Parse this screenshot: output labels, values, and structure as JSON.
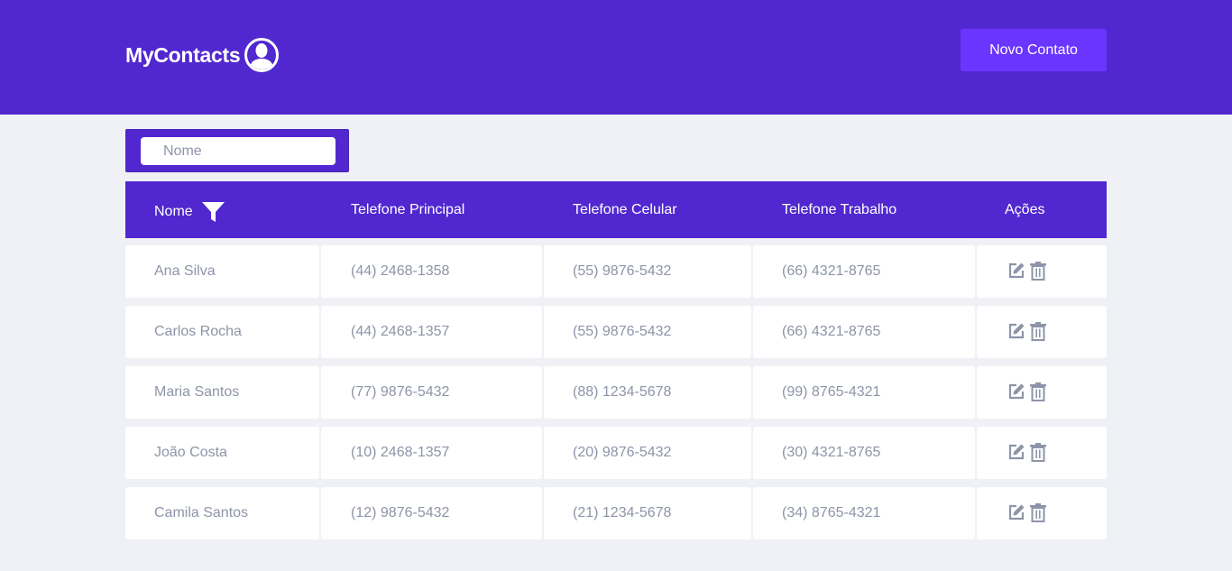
{
  "header": {
    "brand": "MyContacts",
    "new_contact_label": "Novo Contato"
  },
  "search": {
    "placeholder": "Nome"
  },
  "table": {
    "columns": [
      "Nome",
      "Telefone Principal",
      "Telefone Celular",
      "Telefone Trabalho",
      "Ações"
    ],
    "rows": [
      {
        "name": "Ana Silva",
        "principal": "(44) 2468-1358",
        "celular": "(55) 9876-5432",
        "trabalho": "(66) 4321-8765"
      },
      {
        "name": "Carlos Rocha",
        "principal": "(44) 2468-1357",
        "celular": "(55) 9876-5432",
        "trabalho": "(66) 4321-8765"
      },
      {
        "name": "Maria Santos",
        "principal": "(77) 9876-5432",
        "celular": "(88) 1234-5678",
        "trabalho": "(99) 8765-4321"
      },
      {
        "name": "João Costa",
        "principal": "(10) 2468-1357",
        "celular": "(20) 9876-5432",
        "trabalho": "(30) 4321-8765"
      },
      {
        "name": "Camila Santos",
        "principal": "(12) 9876-5432",
        "celular": "(21) 1234-5678",
        "trabalho": "(34) 8765-4321"
      }
    ]
  },
  "icons": {
    "brand": "user-circle-icon",
    "filter": "filter-icon",
    "edit": "edit-icon",
    "delete": "trash-icon"
  },
  "colors": {
    "primary": "#5128cf",
    "button": "#6a35ff",
    "background": "#f0f1f6",
    "row_text": "#8e94a8",
    "action_icon": "#8e94a8"
  }
}
